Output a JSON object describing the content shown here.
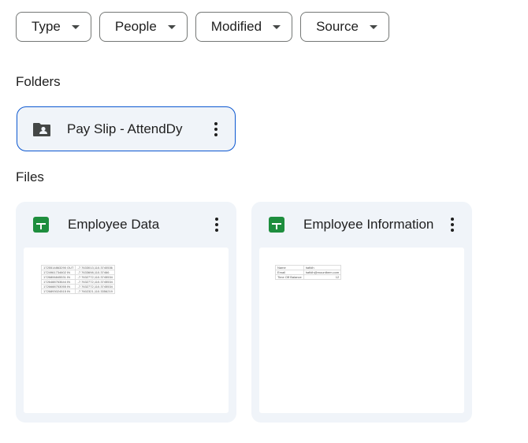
{
  "filters": [
    {
      "label": "Type"
    },
    {
      "label": "People"
    },
    {
      "label": "Modified"
    },
    {
      "label": "Source"
    }
  ],
  "folders_title": "Folders",
  "folder": {
    "name": "Pay Slip - AttendDy",
    "icon": "shared-folder-icon"
  },
  "files_title": "Files",
  "files": [
    {
      "title": "Employee Data",
      "icon": "sheets-icon",
      "thumb_rows": [
        [
          "1725514863290 OUT",
          "-7.7633013,110.3740536"
        ],
        [
          "1724961734602 IN",
          "-7.7633698,110.37466"
        ],
        [
          "1726806845531 IN",
          "-7.7632772,110.3745534"
        ],
        [
          "1726488763644 IN",
          "-7.7632772,110.3745534"
        ],
        [
          "1726688753055 IN",
          "-7.7632772,110.3745534"
        ],
        [
          "1726893024515 IN",
          "-7.7602321,110.3356219"
        ]
      ]
    },
    {
      "title": "Employee Information",
      "icon": "sheets-icon",
      "thumb_rows": [
        [
          "Name",
          "hafidh"
        ],
        [
          "Email",
          "hafidh@mountbem.com"
        ],
        [
          "Time Off Balance",
          "12"
        ]
      ]
    }
  ]
}
